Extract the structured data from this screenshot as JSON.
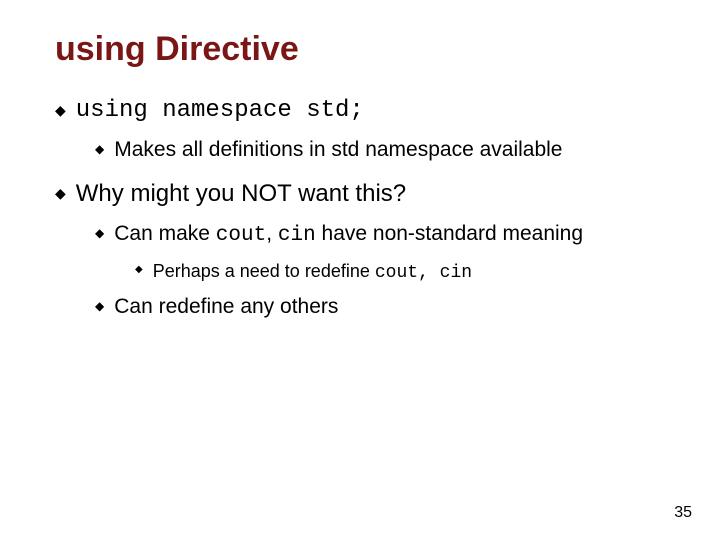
{
  "title": "using Directive",
  "b1": "using namespace std;",
  "b1_1": "Makes all definitions in std namespace available",
  "b2": "Why might you NOT want this?",
  "b2_1_pre": "Can make ",
  "b2_1_c1": "cout",
  "b2_1_mid": ", ",
  "b2_1_c2": "cin",
  "b2_1_post": " have non-standard meaning",
  "b2_1_1_pre": "Perhaps a need to redefine ",
  "b2_1_1_code": "cout, cin",
  "b2_2": "Can redefine any others",
  "page": "35"
}
